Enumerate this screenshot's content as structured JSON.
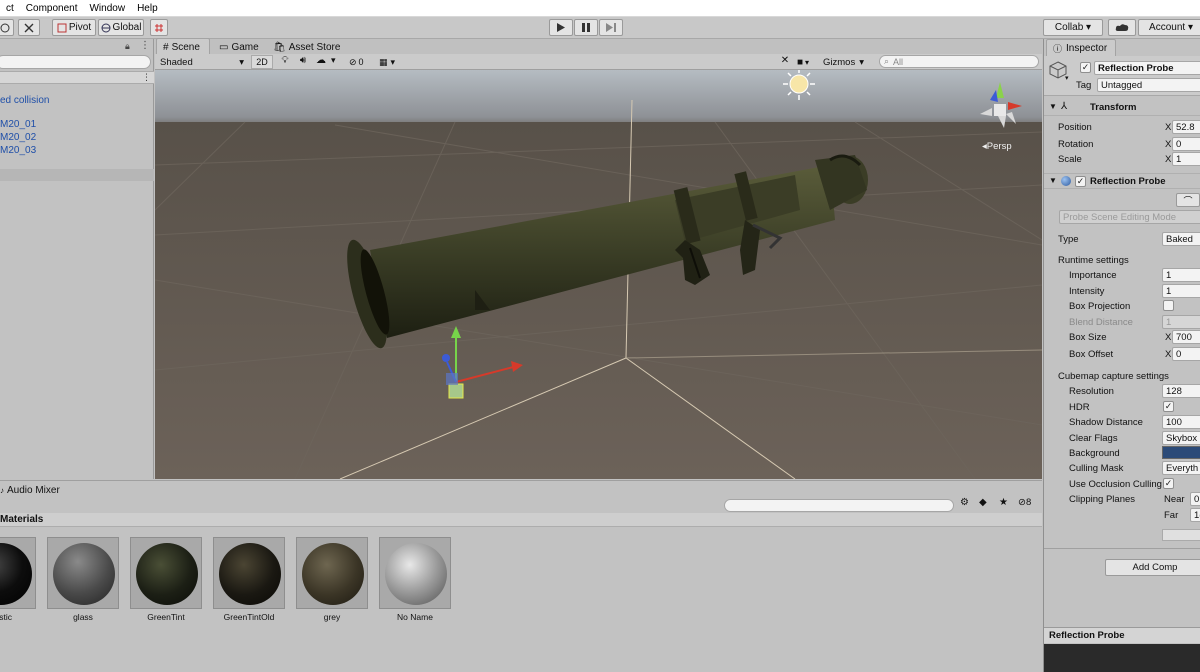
{
  "menubar": {
    "items": [
      "ct",
      "Component",
      "Window",
      "Help"
    ]
  },
  "toolbar": {
    "pivot": "Pivot",
    "global": "Global",
    "collab": "Collab ▾",
    "account": "Account ▾"
  },
  "hierarchy": {
    "items": [
      "ed collision",
      "M20_01",
      "M20_02",
      "M20_03"
    ]
  },
  "scene_tabs": {
    "scene": "Scene",
    "game": "Game",
    "asset_store": "Asset Store"
  },
  "scene_bar": {
    "shading": "Shaded",
    "mode_2d": "2D",
    "hidden_count": "0",
    "gizmos": "Gizmos",
    "search_placeholder": "All"
  },
  "scene_view": {
    "persp_label": "Persp"
  },
  "project": {
    "tab": "Audio Mixer",
    "folder": "Materials",
    "hidden_count": "8",
    "materials": [
      {
        "name": "plastic",
        "color": "#0d0d0d"
      },
      {
        "name": "glass",
        "color": "#4a4a4a"
      },
      {
        "name": "GreenTint",
        "color": "#1c1f15"
      },
      {
        "name": "GreenTintOld",
        "color": "#1a1812"
      },
      {
        "name": "grey",
        "color": "#3b3526"
      },
      {
        "name": "No Name",
        "color": "#8a8a8a"
      }
    ]
  },
  "inspector": {
    "tab": "Inspector",
    "object_name": "Reflection Probe",
    "tag_label": "Tag",
    "tag_value": "Untagged",
    "transform": {
      "title": "Transform",
      "position_label": "Position",
      "position_x": "52.8",
      "rotation_label": "Rotation",
      "rotation_x": "0",
      "scale_label": "Scale",
      "scale_x": "1",
      "x": "X"
    },
    "probe": {
      "title": "Reflection Probe",
      "editing_mode": "Probe Scene Editing Mode",
      "type_label": "Type",
      "type_value": "Baked",
      "runtime_settings": "Runtime settings",
      "importance_label": "Importance",
      "importance_value": "1",
      "intensity_label": "Intensity",
      "intensity_value": "1",
      "box_projection_label": "Box Projection",
      "blend_distance_label": "Blend Distance",
      "blend_distance_value": "1",
      "box_size_label": "Box Size",
      "box_size_x": "700",
      "box_offset_label": "Box Offset",
      "box_offset_x": "0",
      "cubemap_settings": "Cubemap capture settings",
      "resolution_label": "Resolution",
      "resolution_value": "128",
      "hdr_label": "HDR",
      "shadow_distance_label": "Shadow Distance",
      "shadow_distance_value": "100",
      "clear_flags_label": "Clear Flags",
      "clear_flags_value": "Skybox",
      "background_label": "Background",
      "background_color": "#2b4a78",
      "culling_mask_label": "Culling Mask",
      "culling_mask_value": "Everyth",
      "occlusion_label": "Use Occlusion Culling",
      "clipping_label": "Clipping Planes",
      "near_label": "Near",
      "near_value": "0",
      "far_label": "Far",
      "far_value": "1("
    },
    "add_component": "Add Comp",
    "preview_title": "Reflection Probe"
  }
}
